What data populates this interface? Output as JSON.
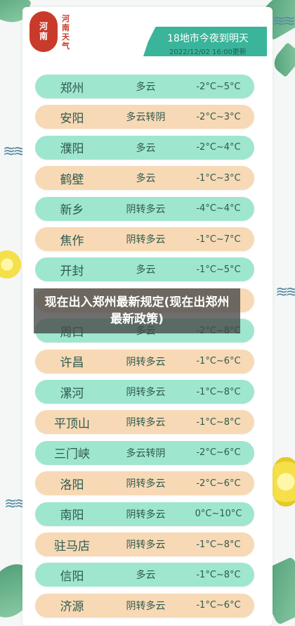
{
  "logo": {
    "glyph": "河南",
    "brand": "河南天气"
  },
  "banner": {
    "title": "18地市今夜到明天",
    "time": "2022/12/02 16:00更新"
  },
  "forecast": [
    {
      "city": "郑州",
      "weather": "多云",
      "temp": "-2°C~5°C",
      "color": "green"
    },
    {
      "city": "安阳",
      "weather": "多云转阴",
      "temp": "-2°C~3°C",
      "color": "orange"
    },
    {
      "city": "濮阳",
      "weather": "多云",
      "temp": "-2°C~4°C",
      "color": "green"
    },
    {
      "city": "鹤壁",
      "weather": "多云",
      "temp": "-1°C~3°C",
      "color": "orange"
    },
    {
      "city": "新乡",
      "weather": "阴转多云",
      "temp": "-4°C~4°C",
      "color": "green"
    },
    {
      "city": "焦作",
      "weather": "阴转多云",
      "temp": "-1°C~7°C",
      "color": "orange"
    },
    {
      "city": "开封",
      "weather": "多云",
      "temp": "-1°C~5°C",
      "color": "green"
    },
    {
      "city": "",
      "weather": "",
      "temp": "",
      "color": "orange"
    },
    {
      "city": "周口",
      "weather": "多云",
      "temp": "-2°C~8°C",
      "color": "green"
    },
    {
      "city": "许昌",
      "weather": "阴转多云",
      "temp": "-1°C~6°C",
      "color": "orange"
    },
    {
      "city": "漯河",
      "weather": "阴转多云",
      "temp": "-1°C~8°C",
      "color": "green"
    },
    {
      "city": "平顶山",
      "weather": "阴转多云",
      "temp": "-1°C~8°C",
      "color": "orange"
    },
    {
      "city": "三门峡",
      "weather": "多云转阴",
      "temp": "-2°C~6°C",
      "color": "green"
    },
    {
      "city": "洛阳",
      "weather": "阴转多云",
      "temp": "-2°C~6°C",
      "color": "orange"
    },
    {
      "city": "南阳",
      "weather": "阴转多云",
      "temp": "0°C~10°C",
      "color": "green"
    },
    {
      "city": "驻马店",
      "weather": "阴转多云",
      "temp": "-1°C~8°C",
      "color": "orange"
    },
    {
      "city": "信阳",
      "weather": "多云",
      "temp": "-1°C~8°C",
      "color": "green"
    },
    {
      "city": "济源",
      "weather": "阴转多云",
      "temp": "-1°C~6°C",
      "color": "orange"
    }
  ],
  "overlay": {
    "text": "现在出入郑州最新规定(现在出郑州最新政策)"
  },
  "colors": {
    "green": "#9fe6cf",
    "orange": "#f7d9b5",
    "banner": "#3ab49a",
    "logo": "#c93a2a"
  }
}
